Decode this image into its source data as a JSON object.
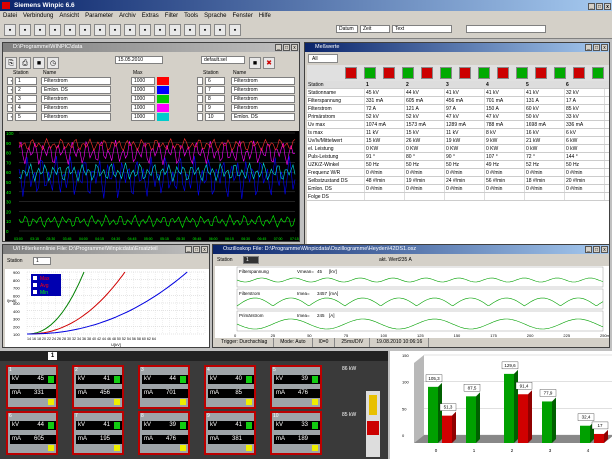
{
  "app": {
    "title": "Siemens Winpic 6.6"
  },
  "menu": [
    "Datei",
    "Verbindung",
    "Ansicht",
    "Parameter",
    "Archiv",
    "Extras",
    "Filter",
    "Tools",
    "Sprache",
    "Fenster",
    "Hilfe"
  ],
  "topbar": {
    "datum": "Datum",
    "zeit": "Zeit",
    "text": "Text"
  },
  "trend": {
    "title": "D:\\Programme\\WINPIC\\data",
    "date": "15.05.2010",
    "preset": "default.sel",
    "col_station": "Station",
    "col_name": "Name",
    "col_max": "Max",
    "rows_left": [
      {
        "n": "1",
        "name": "Filterstrom",
        "max": "1000"
      },
      {
        "n": "2",
        "name": "Emlon. DS",
        "max": "1000"
      },
      {
        "n": "3",
        "name": "Filterstrom",
        "max": "1000"
      },
      {
        "n": "4",
        "name": "Filterstrom",
        "max": "1000"
      },
      {
        "n": "5",
        "name": "Filterstrom",
        "max": "1000"
      }
    ],
    "rows_right": [
      {
        "n": "6",
        "name": "Filterstrom"
      },
      {
        "n": "7",
        "name": "Filterstrom"
      },
      {
        "n": "8",
        "name": "Filterstrom"
      },
      {
        "n": "9",
        "name": "Filterstrom"
      },
      {
        "n": "10",
        "name": "Emlon. DS"
      }
    ],
    "yticks": [
      "100",
      "90",
      "80",
      "70",
      "60",
      "50",
      "40",
      "30",
      "20",
      "10",
      "0"
    ],
    "xticks": [
      "03:00",
      "03:15",
      "03:30",
      "03:45",
      "04:00",
      "04:15",
      "04:30",
      "04:45",
      "05:00",
      "05:15",
      "05:30",
      "05:45",
      "06:00",
      "06:15",
      "06:30",
      "06:45",
      "07:00",
      "07:15"
    ]
  },
  "meas": {
    "title": "Meßwerte",
    "tab": "All",
    "station_label": "Station",
    "labels": [
      "Stationname",
      "Filterspannung",
      "Filterstrom",
      "Primärstrom",
      "Uv max",
      "Is max",
      "Uv/Iv/Mittelwert",
      "el. Leistung",
      "Puls-Leistung",
      "UZK/Z-Winkel",
      "Frequenz W/R",
      "Selbstzustand DS",
      "Emlon. DS",
      "Folge DS"
    ],
    "cols": [
      [
        "1",
        "45 kV",
        "331 mA",
        "72 A",
        "52 kV",
        "1074 mA",
        "11 kV",
        "15 kW",
        "0 KW",
        "91 °",
        "50 Hz",
        "0 #/min",
        "48 #/min",
        "0 #/min"
      ],
      [
        "2",
        "44 kV",
        "605 mA",
        "121 A",
        "52 kV",
        "1573 mA",
        "15 kV",
        "26 kW",
        "0 KW",
        "80 °",
        "50 Hz",
        "0 #/min",
        "19 #/min",
        "0 #/min"
      ],
      [
        "3",
        "41 kV",
        "456 mA",
        "97 A",
        "47 kV",
        "1289 mA",
        "11 kV",
        "19 kW",
        "0 KW",
        "90 °",
        "50 Hz",
        "0 #/min",
        "24 #/min",
        "0 #/min"
      ],
      [
        "4",
        "41 kV",
        "701 mA",
        "150 A",
        "47 kV",
        "788 mA",
        "8 kV",
        "9 kW",
        "0 KW",
        "107 °",
        "49 Hz",
        "0 #/min",
        "56 #/min",
        "0 #/min"
      ],
      [
        "5",
        "41 kV",
        "131 A",
        "60 kV",
        "50 kV",
        "1698 mA",
        "16 kV",
        "21 kW",
        "0 kW",
        "72 °",
        "52 Hz",
        "0 #/min",
        "18 #/min",
        "0 #/min"
      ],
      [
        "6",
        "32 kV",
        "17 A",
        "85 kV",
        "33 kV",
        "336 mA",
        "6 kV",
        "6 kW",
        "0 kW",
        "144 °",
        "50 Hz",
        "0 #/min",
        "20 #/min",
        "0 #/min"
      ]
    ]
  },
  "env": {
    "title": "U/I Filterkennlinie File: D:\\Programme\\Winpicdata\\Ersatzteil",
    "station_label": "Station",
    "station": "1",
    "legend": [
      "Max",
      "Avg",
      "Min"
    ],
    "yticks": [
      "900",
      "800",
      "700",
      "600",
      "500",
      "400",
      "300",
      "200",
      "100"
    ],
    "xlabel": "U[kV]",
    "ylabel": "I[mA]",
    "xticks": "14 16 18 20 22 24 26 28 30 32 34 36 38 40 42 44 46 48 50 52 54 56 58 60 62 64"
  },
  "osc": {
    "title": "Oszilloskop File: D:\\Programme\\Winpicdata\\Oszillogramme\\Heyden\\42DS1.osz",
    "station_label": "Station",
    "station": "1",
    "akt_wert_label": "akt. Wert:",
    "akt_wert": "235 A",
    "ch1": {
      "name": "Filterspannung",
      "meas_label": "Vmean=",
      "meas": "45",
      "unit": "[kV]"
    },
    "ch2": {
      "name": "Filterstrom",
      "meas_label": "Imea=",
      "meas": "3457",
      "unit": "[mA]"
    },
    "ch3": {
      "name": "Primärstrom",
      "meas_label": "Imea=",
      "meas": "245",
      "unit": "[A]"
    },
    "xticks": [
      "0",
      "25",
      "50",
      "75",
      "100",
      "125",
      "150",
      "175",
      "200",
      "225",
      "250ms"
    ],
    "status": [
      "Trigger: Durchschlag",
      "Mode: Auto",
      "I0=0",
      "25ms/DIV",
      "19.08.2010 10:06:16"
    ]
  },
  "rack": {
    "header_no": "1",
    "cards": [
      {
        "st": "1",
        "kv": "45",
        "ma": "331"
      },
      {
        "st": "2",
        "kv": "41",
        "ma": "456"
      },
      {
        "st": "3",
        "kv": "44",
        "ma": "701"
      },
      {
        "st": "4",
        "kv": "40",
        "ma": "85"
      },
      {
        "st": "5",
        "kv": "39",
        "ma": "476"
      },
      {
        "st": "6",
        "kv": "44",
        "ma": "605"
      },
      {
        "st": "7",
        "kv": "41",
        "ma": "195"
      },
      {
        "st": "8",
        "kv": "39",
        "ma": "476"
      },
      {
        "st": "9",
        "kv": "41",
        "ma": "381"
      },
      {
        "st": "10",
        "kv": "33",
        "ma": "189"
      }
    ],
    "side_top": "86 kW",
    "side_bot": "85 kW",
    "kv_unit": "kV",
    "ma_unit": "mA"
  },
  "bars": {
    "labels": [
      "105,3",
      "51,3",
      "87,5",
      "129,6",
      "91,4",
      "77,9",
      "32,4",
      "17"
    ],
    "xticks": [
      "0",
      "1",
      "2",
      "3",
      "4"
    ],
    "yticks": [
      "150",
      "100",
      "50",
      "0"
    ],
    "groups": [
      [
        105.3,
        51.3
      ],
      [
        87.5,
        0
      ],
      [
        129.6,
        91.4
      ],
      [
        77.9,
        0
      ],
      [
        32.4,
        17
      ]
    ]
  }
}
